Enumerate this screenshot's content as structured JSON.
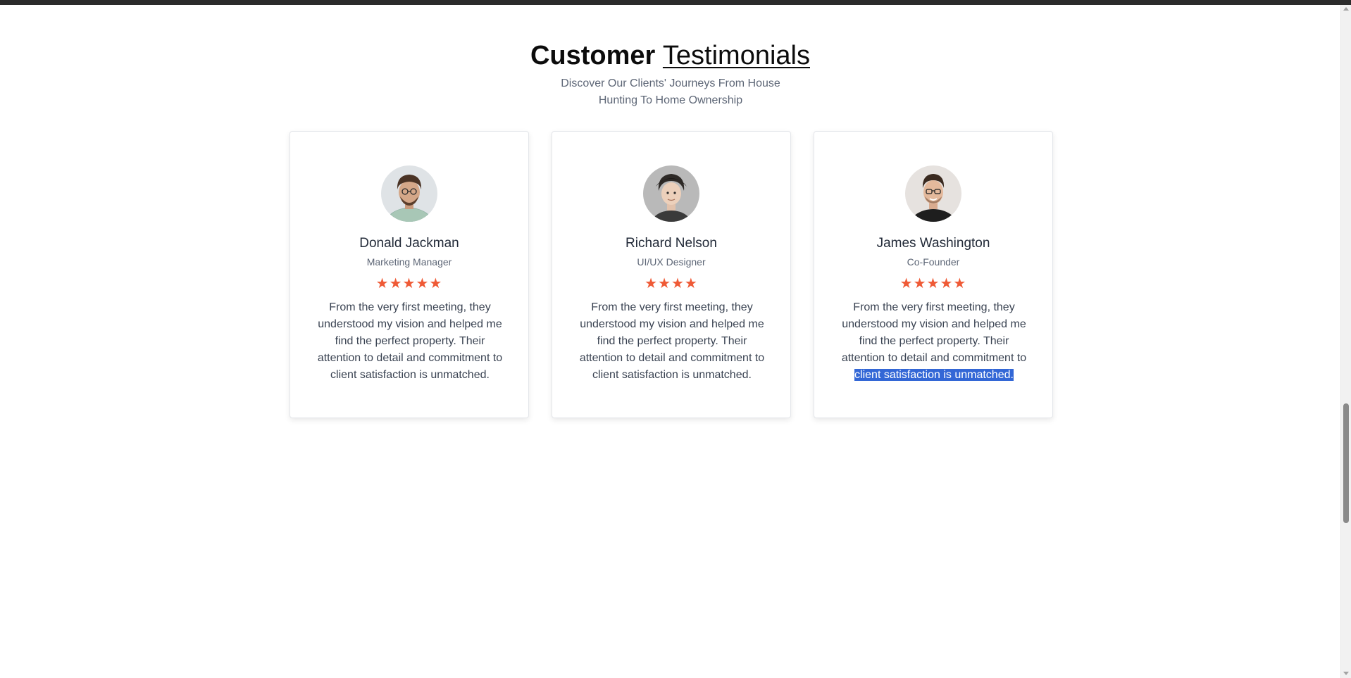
{
  "section": {
    "title_bold": "Customer",
    "title_light": "Testimonials",
    "subtitle": "Discover Our Clients' Journeys From House Hunting To Home Ownership"
  },
  "colors": {
    "star": "#ef5a36",
    "selection": "#3367d6"
  },
  "testimonials": [
    {
      "name": "Donald Jackman",
      "role": "Marketing Manager",
      "rating": 5,
      "stars": "★★★★★",
      "quote": "From the very first meeting, they understood my vision and helped me find the perfect property. Their attention to detail and commitment to client satisfaction is unmatched."
    },
    {
      "name": "Richard Nelson",
      "role": "UI/UX Designer",
      "rating": 4,
      "stars": "★★★★",
      "quote": "From the very first meeting, they understood my vision and helped me find the perfect property. Their attention to detail and commitment to client satisfaction is unmatched."
    },
    {
      "name": "James Washington",
      "role": "Co-Founder",
      "rating": 5,
      "stars": "★★★★★",
      "quote_start": "From the very first meeting, they understood my vision and helped me find the perfect property. Their attention to detail and commitment to ",
      "quote_selected": "client satisfaction is unmatched."
    }
  ]
}
